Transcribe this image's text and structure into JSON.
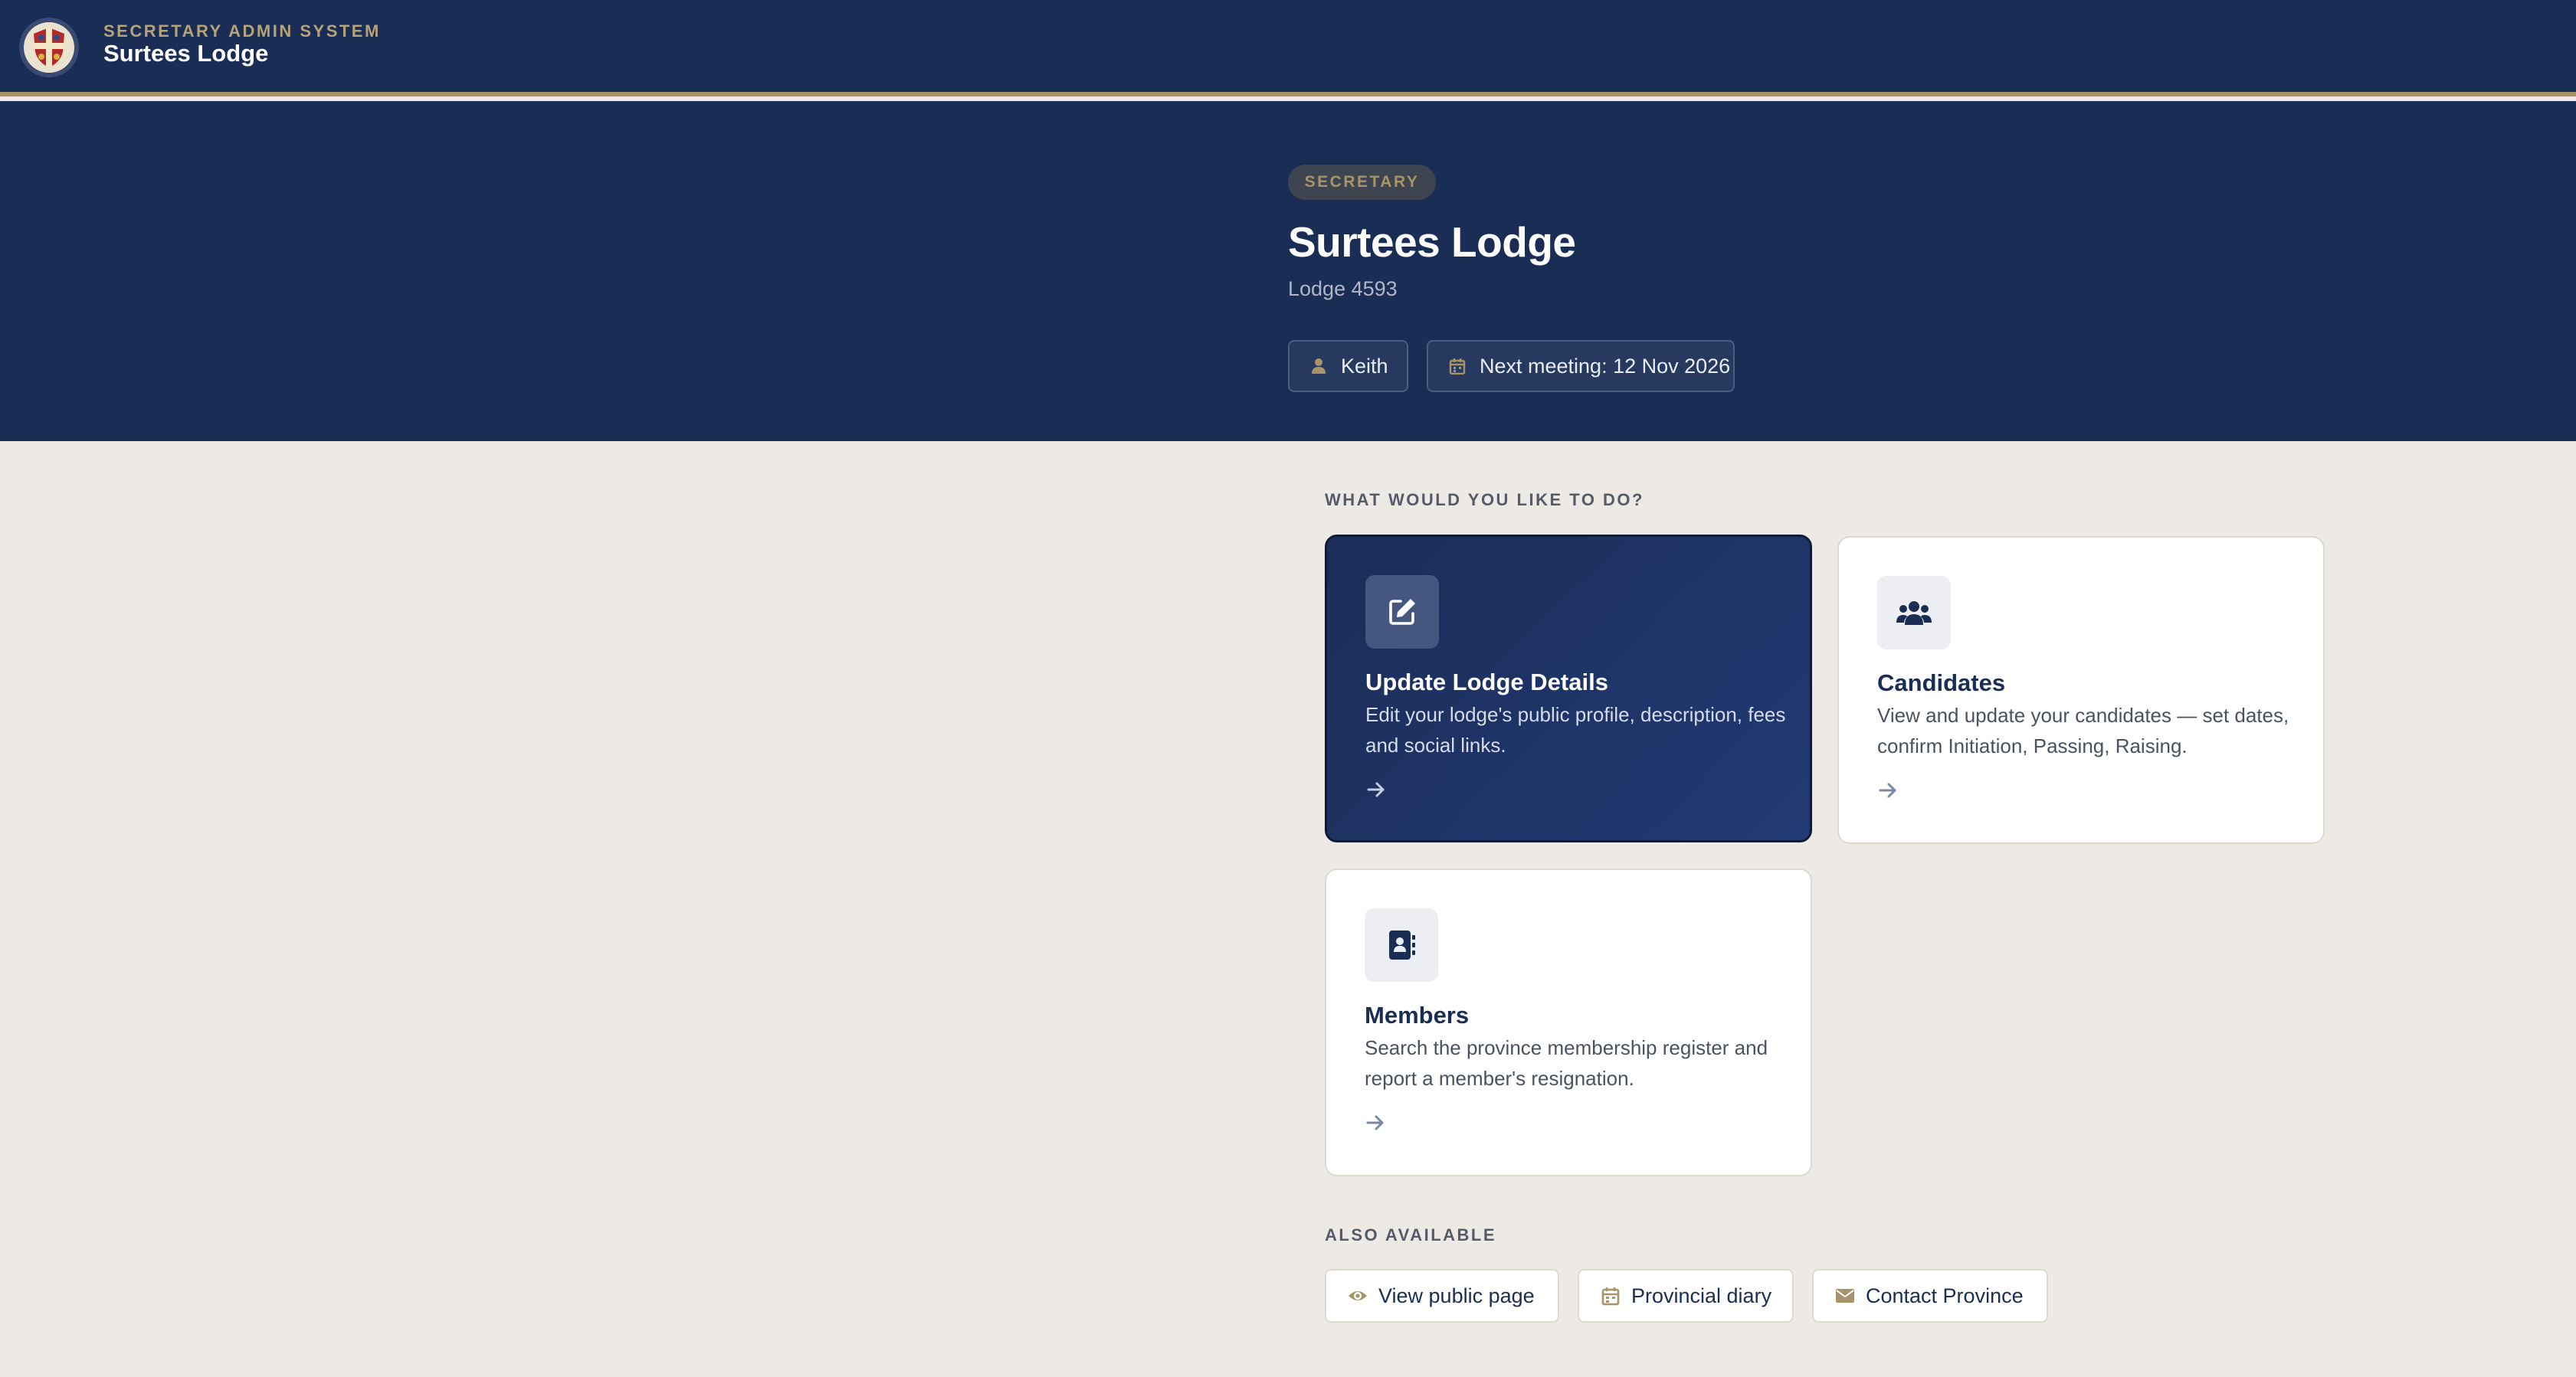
{
  "header": {
    "system_label": "SECRETARY ADMIN SYSTEM",
    "lodge_name": "Surtees Lodge",
    "logo_icon": "lodge-crest-icon"
  },
  "hero": {
    "role_badge": "SECRETARY",
    "title": "Surtees Lodge",
    "lodge_number": "Lodge 4593",
    "user_chip": {
      "icon": "user-icon",
      "label": "Keith"
    },
    "meeting_chip": {
      "icon": "calendar-icon",
      "label": "Next meeting: 12 Nov 2026"
    }
  },
  "actions": {
    "section_label": "WHAT WOULD YOU LIKE TO DO?",
    "cards": [
      {
        "icon": "edit-icon",
        "title": "Update Lodge Details",
        "description": "Edit your lodge's public profile, description, fees and social links."
      },
      {
        "icon": "users-icon",
        "title": "Candidates",
        "description": "View and update your candidates — set dates, confirm Initiation, Passing, Raising."
      },
      {
        "icon": "address-book-icon",
        "title": "Members",
        "description": "Search the province membership register and report a member's resignation."
      }
    ]
  },
  "also_available": {
    "section_label": "ALSO AVAILABLE",
    "links": [
      {
        "icon": "eye-icon",
        "label": "View public page"
      },
      {
        "icon": "calendar-icon",
        "label": "Provincial diary"
      },
      {
        "icon": "envelope-icon",
        "label": "Contact Province"
      }
    ]
  },
  "colors": {
    "navy": "#1a2d55",
    "gold": "#a8946a",
    "background": "#edeae5",
    "card": "#ffffff"
  }
}
